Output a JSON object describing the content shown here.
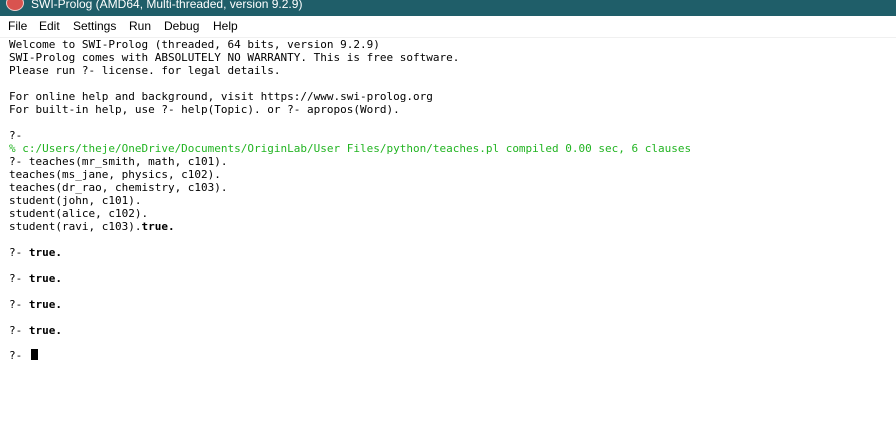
{
  "window": {
    "title": "SWI-Prolog (AMD64, Multi-threaded, version 9.2.9)"
  },
  "menu": {
    "items": [
      "File",
      "Edit",
      "Settings",
      "Run",
      "Debug",
      "Help"
    ]
  },
  "console": {
    "banner": [
      "Welcome to SWI-Prolog (threaded, 64 bits, version 9.2.9)",
      "SWI-Prolog comes with ABSOLUTELY NO WARRANTY. This is free software.",
      "Please run ?- license. for legal details.",
      "For online help and background, visit https://www.swi-prolog.org",
      "For built-in help, use ?- help(Topic). or ?- apropos(Word)."
    ],
    "first_prompt": "?-",
    "consult_message": "% c:/Users/theje/OneDrive/Documents/OriginLab/User Files/python/teaches.pl compiled 0.00 sec, 6 clauses",
    "query_lines": [
      "?- teaches(mr_smith, math, c101).",
      "teaches(ms_jane, physics, c102).",
      "teaches(dr_rao, chemistry, c103).",
      "student(john, c101).",
      "student(alice, c102).",
      "student(ravi, c103)."
    ],
    "prompt": "?- ",
    "answer": "true.",
    "results": [
      "true.",
      "true.",
      "true.",
      "true."
    ],
    "final_prompt": "?- "
  },
  "colors": {
    "titlebar": "#1f5e69",
    "consult_message": "#22b422"
  }
}
